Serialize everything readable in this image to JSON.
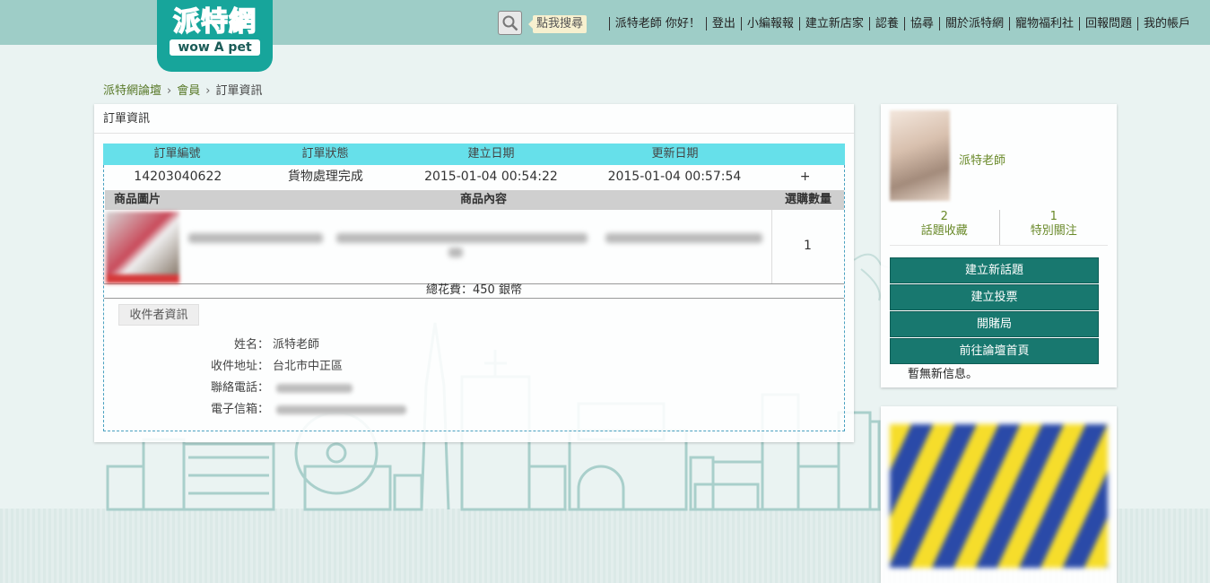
{
  "brand": {
    "logo_cn": [
      "派",
      "特",
      "網"
    ],
    "logo_en": "wow A pet"
  },
  "header": {
    "search_tip": "點我搜尋",
    "nav": [
      "派特老師 你好！",
      "登出",
      "小編報報",
      "建立新店家",
      "認養",
      "協尋",
      "關於派特網",
      "寵物福利社",
      "回報問題",
      "我的帳戶"
    ]
  },
  "breadcrumb": {
    "items": [
      "派特網論壇",
      "會員"
    ],
    "current": "訂單資訊",
    "sep": "›"
  },
  "order": {
    "panel_title": "訂單資訊",
    "headers": {
      "number": "訂單編號",
      "status": "訂單狀態",
      "created": "建立日期",
      "updated": "更新日期"
    },
    "row": {
      "number": "14203040622",
      "status": "貨物處理完成",
      "created": "2015-01-04 00:54:22",
      "updated": "2015-01-04 00:57:54",
      "toggle": "+"
    },
    "items_headers": {
      "image": "商品圖片",
      "content": "商品內容",
      "qty": "選購數量"
    },
    "item": {
      "qty": "1"
    },
    "total": "總花費：450 銀幣",
    "receiver": {
      "button": "收件者資訊",
      "name_label": "姓名：",
      "name": "派特老師",
      "address_label": "收件地址：",
      "address": "台北市中正區",
      "phone_label": "聯絡電話：",
      "email_label": "電子信箱："
    }
  },
  "sidebar": {
    "user_name": "派特老師",
    "stats": [
      {
        "value": "2",
        "label": "話題收藏"
      },
      {
        "value": "1",
        "label": "特別關注"
      }
    ],
    "buttons": [
      "建立新話題",
      "建立投票",
      "開賭局",
      "前往論壇首頁"
    ],
    "no_message": "暫無新信息。"
  },
  "colors": {
    "topbar": "#9ecdc7",
    "logo_bg": "#17a59b",
    "table_header": "#66e0ea",
    "button": "#18786f"
  }
}
